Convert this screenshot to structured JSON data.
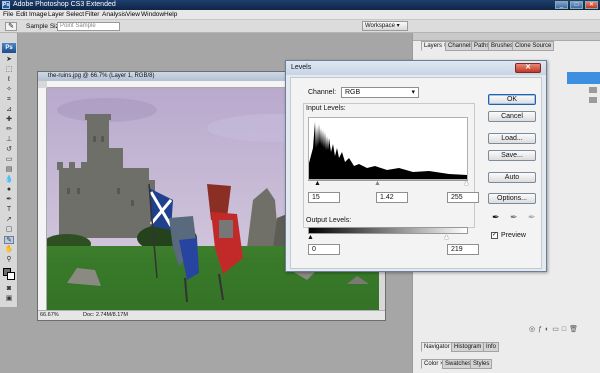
{
  "app": {
    "title": "Adobe Photoshop CS3 Extended",
    "logo_text": "Ps"
  },
  "window_controls": {
    "minimize": "_",
    "maximize": "□",
    "close": "✕"
  },
  "menu": [
    "File",
    "Edit",
    "Image",
    "Layer",
    "Select",
    "Filter",
    "Analysis",
    "View",
    "Window",
    "Help"
  ],
  "options_bar": {
    "sample_size_label": "Sample Size:",
    "sample_size_value": "Point Sample",
    "workspace_label": "Workspace ▾"
  },
  "panels": {
    "top_tabs": [
      "Layers ×",
      "Channels",
      "Paths",
      "Brushes",
      "Clone Source"
    ],
    "bottom1_tabs": [
      "Navigator ×",
      "Histogram",
      "Info"
    ],
    "bottom2_tabs": [
      "Color ×",
      "Swatches",
      "Styles"
    ]
  },
  "document": {
    "title": "the-ruins.jpg @ 66.7% (Layer 1, RGB/8)",
    "zoom": "66.67%",
    "doc_size": "Doc: 2.74M/8.17M"
  },
  "levels": {
    "title": "Levels",
    "close": "✕",
    "channel_label": "Channel:",
    "channel_value": "RGB",
    "input_label": "Input Levels:",
    "input_black": "15",
    "input_gamma": "1.42",
    "input_white": "255",
    "output_label": "Output Levels:",
    "output_black": "0",
    "output_white": "219",
    "buttons": {
      "ok": "OK",
      "cancel": "Cancel",
      "load": "Load...",
      "save": "Save...",
      "auto": "Auto",
      "options": "Options..."
    },
    "preview_label": "Preview",
    "preview_checked": "✓"
  }
}
